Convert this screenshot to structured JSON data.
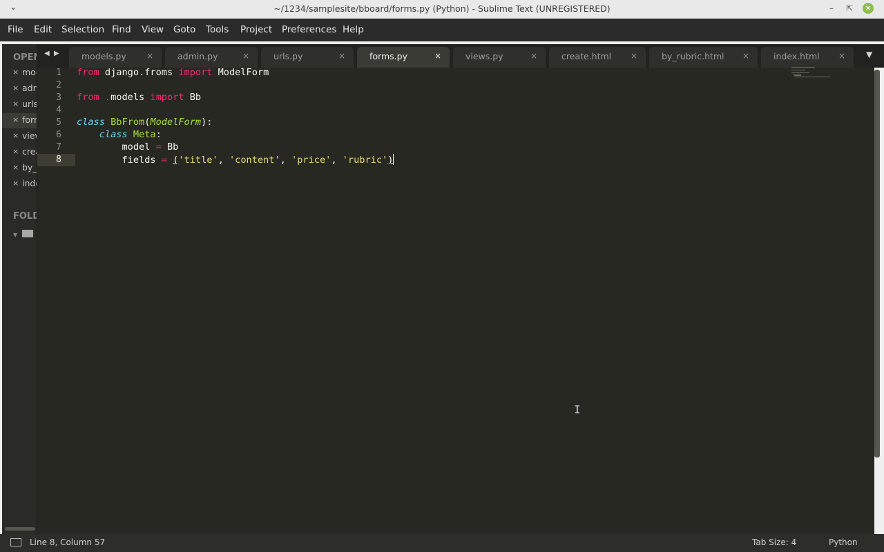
{
  "window": {
    "title": "~/1234/samplesite/bboard/forms.py (Python) - Sublime Text (UNREGISTERED)",
    "menu_icon": "chevron-down-icon",
    "controls": [
      "minimize",
      "maximize",
      "close"
    ]
  },
  "menu": [
    "File",
    "Edit",
    "Selection",
    "Find",
    "View",
    "Goto",
    "Tools",
    "Project",
    "Preferences",
    "Help"
  ],
  "sidebar": {
    "open_files_header": "OPEN",
    "open_files": [
      {
        "label": "mod",
        "close": "×"
      },
      {
        "label": "adm",
        "close": "×"
      },
      {
        "label": "urls",
        "close": "×"
      },
      {
        "label": "form",
        "close": "×",
        "active": true
      },
      {
        "label": "view",
        "close": "×"
      },
      {
        "label": "crea",
        "close": "×"
      },
      {
        "label": "by_",
        "close": "×"
      },
      {
        "label": "inde",
        "close": "×"
      }
    ],
    "folders_header": "FOLD",
    "folder_icon": "folder-icon"
  },
  "tabs": [
    {
      "label": "models.py",
      "close": "×"
    },
    {
      "label": "admin.py",
      "close": "×"
    },
    {
      "label": "urls.py",
      "close": "×"
    },
    {
      "label": "forms.py",
      "close": "×",
      "active": true
    },
    {
      "label": "views.py",
      "close": "×"
    },
    {
      "label": "create.html",
      "close": "×"
    },
    {
      "label": "by_rubric.html",
      "close": "×"
    },
    {
      "label": "index.html",
      "close": "×"
    }
  ],
  "editor": {
    "line_numbers": [
      "1",
      "2",
      "3",
      "4",
      "5",
      "6",
      "7",
      "8"
    ],
    "current_line": 8,
    "tokens": {
      "l1": [
        "from",
        " django.froms ",
        "import",
        " ModelForm"
      ],
      "l3": [
        "from",
        " .",
        "models ",
        "import",
        " Bb"
      ],
      "l5": [
        "class",
        " ",
        "BbFrom",
        "(",
        "ModelForm",
        "):"
      ],
      "l6": [
        "    ",
        "class",
        " ",
        "Meta",
        ":"
      ],
      "l7": [
        "        model ",
        "=",
        " Bb"
      ],
      "l8": [
        "        fields ",
        "=",
        " ",
        "(",
        "'title'",
        ", ",
        "'content'",
        ", ",
        "'price'",
        ", ",
        "'rubric'",
        ")"
      ]
    }
  },
  "status": {
    "position": "Line 8, Column 57",
    "tab_size": "Tab Size: 4",
    "syntax": "Python"
  }
}
